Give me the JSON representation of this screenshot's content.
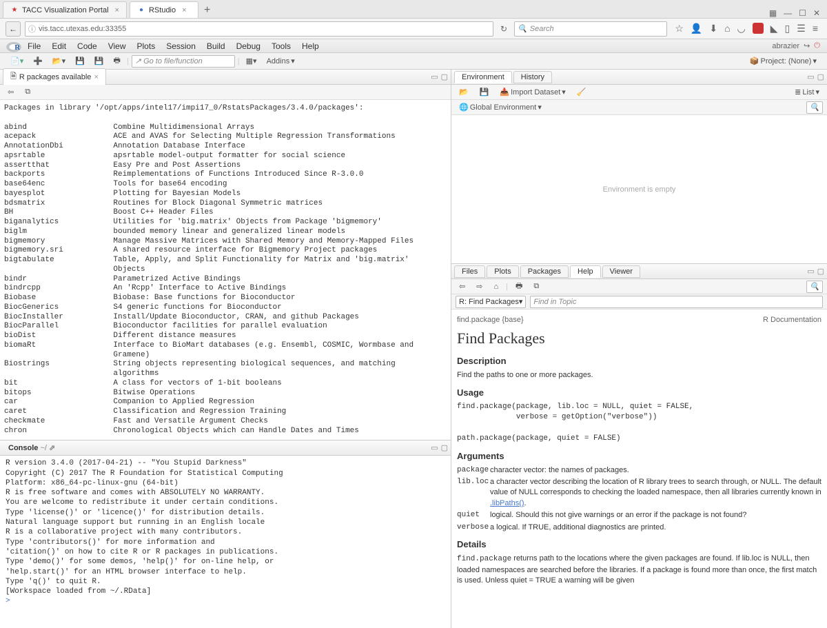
{
  "browser": {
    "tabs": [
      {
        "title": "TACC Visualization Portal",
        "fav": "★",
        "favcolor": "#c33"
      },
      {
        "title": "RStudio",
        "fav": "●",
        "favcolor": "#4477cc"
      }
    ],
    "url": "vis.tacc.utexas.edu:33355",
    "search_placeholder": "Search"
  },
  "rstudio": {
    "menu": [
      "File",
      "Edit",
      "Code",
      "View",
      "Plots",
      "Session",
      "Build",
      "Debug",
      "Tools",
      "Help"
    ],
    "user": "abrazier",
    "goto_placeholder": "Go to file/function",
    "addins_label": "Addins",
    "project_label": "Project: (None)"
  },
  "source": {
    "tab": "R packages available",
    "header_line": "Packages in library '/opt/apps/intel17/impi17_0/RstatsPackages/3.4.0/packages':",
    "packages": [
      [
        "abind",
        "Combine Multidimensional Arrays"
      ],
      [
        "acepack",
        "ACE and AVAS for Selecting Multiple Regression Transformations"
      ],
      [
        "AnnotationDbi",
        "Annotation Database Interface"
      ],
      [
        "apsrtable",
        "apsrtable model-output formatter for social science"
      ],
      [
        "assertthat",
        "Easy Pre and Post Assertions"
      ],
      [
        "backports",
        "Reimplementations of Functions Introduced Since R-3.0.0"
      ],
      [
        "base64enc",
        "Tools for base64 encoding"
      ],
      [
        "bayesplot",
        "Plotting for Bayesian Models"
      ],
      [
        "bdsmatrix",
        "Routines for Block Diagonal Symmetric matrices"
      ],
      [
        "BH",
        "Boost C++ Header Files"
      ],
      [
        "biganalytics",
        "Utilities for 'big.matrix' Objects from Package 'bigmemory'"
      ],
      [
        "biglm",
        "bounded memory linear and generalized linear models"
      ],
      [
        "bigmemory",
        "Manage Massive Matrices with Shared Memory and Memory-Mapped Files"
      ],
      [
        "bigmemory.sri",
        "A shared resource interface for Bigmemory Project packages"
      ],
      [
        "bigtabulate",
        "Table, Apply, and Split Functionality for Matrix and 'big.matrix'\n                        Objects"
      ],
      [
        "bindr",
        "Parametrized Active Bindings"
      ],
      [
        "bindrcpp",
        "An 'Rcpp' Interface to Active Bindings"
      ],
      [
        "Biobase",
        "Biobase: Base functions for Bioconductor"
      ],
      [
        "BiocGenerics",
        "S4 generic functions for Bioconductor"
      ],
      [
        "BiocInstaller",
        "Install/Update Bioconductor, CRAN, and github Packages"
      ],
      [
        "BiocParallel",
        "Bioconductor facilities for parallel evaluation"
      ],
      [
        "bioDist",
        "Different distance measures"
      ],
      [
        "biomaRt",
        "Interface to BioMart databases (e.g. Ensembl, COSMIC, Wormbase and\n                        Gramene)"
      ],
      [
        "Biostrings",
        "String objects representing biological sequences, and matching\n                        algorithms"
      ],
      [
        "bit",
        "A class for vectors of 1-bit booleans"
      ],
      [
        "bitops",
        "Bitwise Operations"
      ],
      [
        "car",
        "Companion to Applied Regression"
      ],
      [
        "caret",
        "Classification and Regression Training"
      ],
      [
        "checkmate",
        "Fast and Versatile Argument Checks"
      ],
      [
        "chron",
        "Chronological Objects which can Handle Dates and Times"
      ]
    ]
  },
  "console": {
    "tab": "Console",
    "path": "~/",
    "lines": [
      "R version 3.4.0 (2017-04-21) -- \"You Stupid Darkness\"",
      "Copyright (C) 2017 The R Foundation for Statistical Computing",
      "Platform: x86_64-pc-linux-gnu (64-bit)",
      "",
      "R is free software and comes with ABSOLUTELY NO WARRANTY.",
      "You are welcome to redistribute it under certain conditions.",
      "Type 'license()' or 'licence()' for distribution details.",
      "",
      "  Natural language support but running in an English locale",
      "",
      "R is a collaborative project with many contributors.",
      "Type 'contributors()' for more information and",
      "'citation()' on how to cite R or R packages in publications.",
      "",
      "Type 'demo()' for some demos, 'help()' for on-line help, or",
      "'help.start()' for an HTML browser interface to help.",
      "Type 'q()' to quit R.",
      "",
      "[Workspace loaded from ~/.RData]",
      ""
    ]
  },
  "env": {
    "tabs": [
      "Environment",
      "History"
    ],
    "import_label": "Import Dataset",
    "scope_label": "Global Environment",
    "list_label": "List",
    "empty_text": "Environment is empty"
  },
  "help": {
    "tabs": [
      "Files",
      "Plots",
      "Packages",
      "Help",
      "Viewer"
    ],
    "crumb": "R: Find Packages",
    "topic_placeholder": "Find in Topic",
    "sig_left": "find.package {base}",
    "sig_right": "R Documentation",
    "title": "Find Packages",
    "desc_h": "Description",
    "desc": "Find the paths to one or more packages.",
    "usage_h": "Usage",
    "usage": "find.package(package, lib.loc = NULL, quiet = FALSE,\n             verbose = getOption(\"verbose\"))\n\npath.package(package, quiet = FALSE)",
    "args_h": "Arguments",
    "args": [
      {
        "name": "package",
        "desc": "character vector: the names of packages."
      },
      {
        "name": "lib.loc",
        "desc": "a character vector describing the location of R library trees to search through, or NULL. The default value of NULL corresponds to checking the loaded namespace, then all libraries currently known in "
      },
      {
        "name": "quiet",
        "desc": "logical. Should this not give warnings or an error if the package is not found?"
      },
      {
        "name": "verbose",
        "desc": "a logical. If TRUE, additional diagnostics are printed."
      }
    ],
    "libpaths_link": ".libPaths()",
    "details_h": "Details",
    "details": "find.package returns path to the locations where the given packages are found. If lib.loc is NULL, then loaded namespaces are searched before the libraries. If a package is found more than once, the first match is used. Unless quiet = TRUE a warning will be given"
  }
}
